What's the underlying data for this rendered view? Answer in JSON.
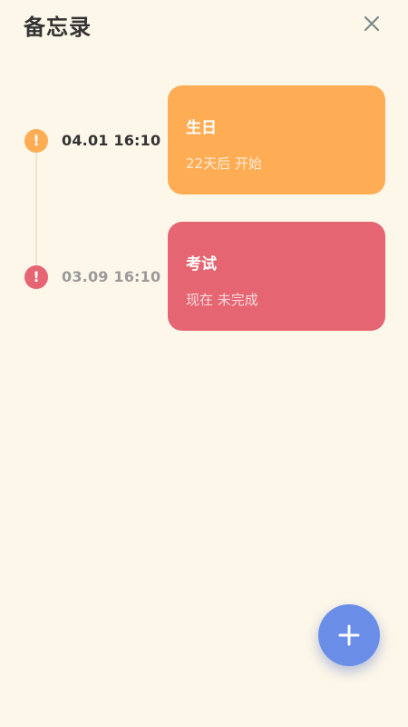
{
  "header": {
    "title": "备忘录",
    "close_icon": "close-icon"
  },
  "entries": [
    {
      "time": "04.01 16:10",
      "title": "生日",
      "subtitle": "22天后  开始",
      "marker_symbol": "!",
      "marker_icon": "alert-icon",
      "card_color": "#ffad55",
      "marker_color": "#ffad55",
      "time_color": "#333333"
    },
    {
      "time": "03.09 16:10",
      "title": "考试",
      "subtitle": "现在  未完成",
      "marker_symbol": "!",
      "marker_icon": "alert-icon",
      "card_color": "#e56672",
      "marker_color": "#e56672",
      "time_color": "#9a9a9a"
    }
  ],
  "fab": {
    "icon": "plus-icon",
    "color": "#6a8ee8"
  },
  "colors": {
    "background": "#fdf7e9",
    "timeline": "#efe4d2"
  }
}
